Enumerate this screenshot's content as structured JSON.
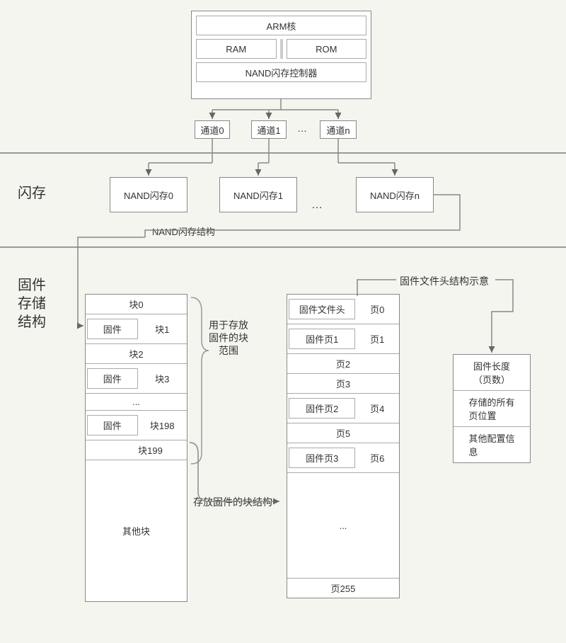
{
  "controller": {
    "arm": "ARM核",
    "ram": "RAM",
    "rom": "ROM",
    "nand_ctrl": "NAND闪存控制器",
    "channels": [
      "通道0",
      "通道1",
      "通道n"
    ],
    "channel_ellipsis": "…"
  },
  "flash": {
    "section_label": "闪存",
    "chips": [
      "NAND闪存0",
      "NAND闪存1",
      "NAND闪存n"
    ],
    "chip_ellipsis": "…",
    "struct_label": "NAND闪存结构"
  },
  "storage": {
    "section_label": "固件\n存储\n结构",
    "block_range_anno": "用于存放\n固件的块\n范围",
    "block_struct_anno": "存放固件的块结构",
    "header_struct_anno": "固件文件头结构示意",
    "blocks": {
      "b0": "块0",
      "fw": "固件",
      "b1": "块1",
      "b2": "块2",
      "b3": "块3",
      "ellipsis": "...",
      "b198": "块198",
      "b199": "块199",
      "other": "其他块"
    },
    "pages": {
      "fw_header": "固件文件头",
      "p0": "页0",
      "fw_p1": "固件页1",
      "p1": "页1",
      "p2": "页2",
      "p3": "页3",
      "fw_p2": "固件页2",
      "p4": "页4",
      "p5": "页5",
      "fw_p3": "固件页3",
      "p6": "页6",
      "ellipsis": "...",
      "p255": "页255"
    },
    "header_info": {
      "len": "固件长度\n（页数）",
      "pages_pos": "存储的所有\n页位置",
      "other_cfg": "其他配置信\n息"
    }
  }
}
